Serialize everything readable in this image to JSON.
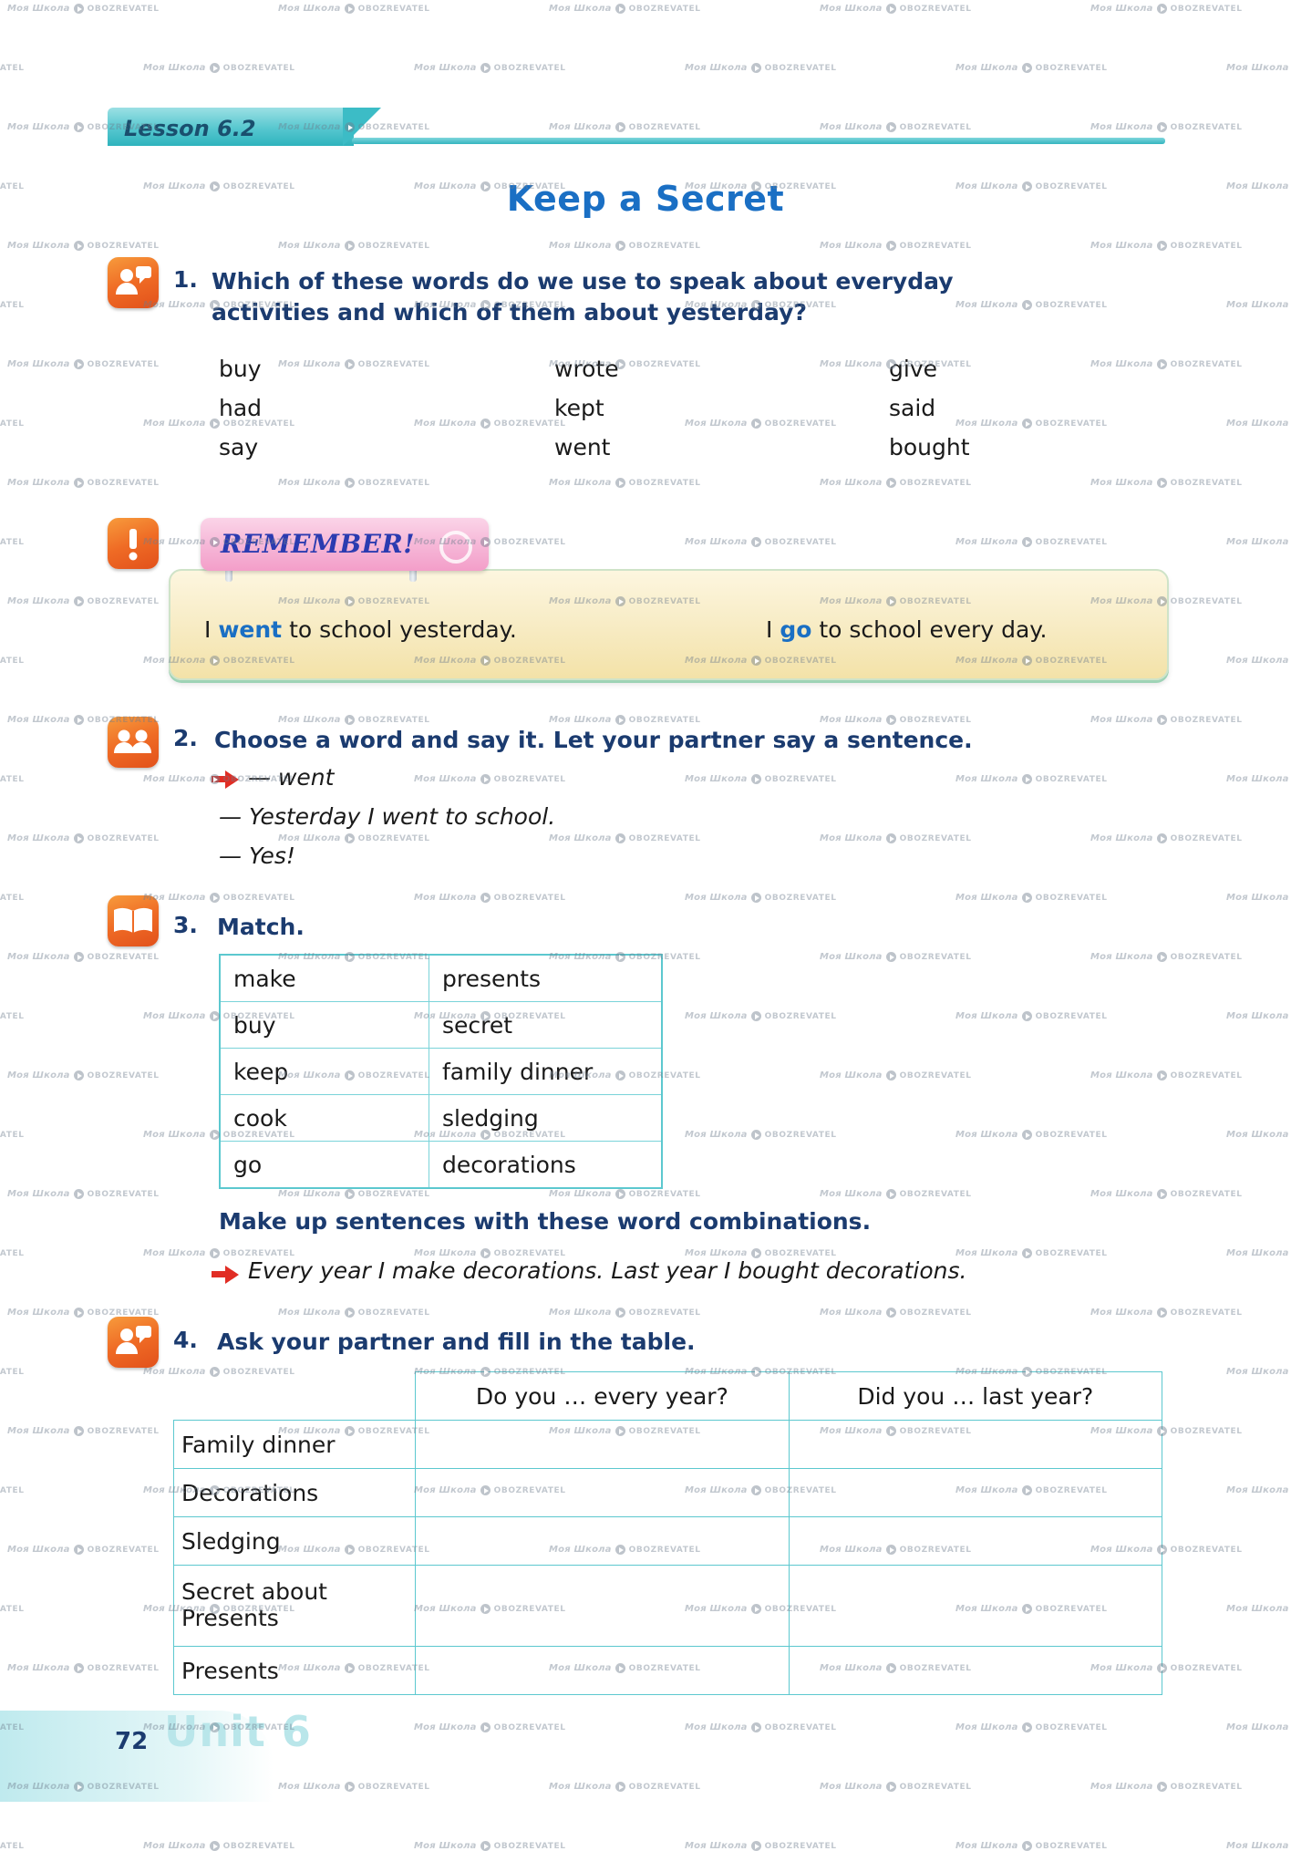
{
  "lesson": {
    "tab_label": "Lesson 6.2",
    "title": "Keep a Secret"
  },
  "tasks": [
    {
      "number": "1.",
      "icon": "person-speech-icon",
      "text_line1": "Which of these words do we use to speak about everyday",
      "text_line2": "activities and which of them about yesterday?",
      "words": {
        "col1": [
          "buy",
          "had",
          "say"
        ],
        "col2": [
          "wrote",
          "kept",
          "went"
        ],
        "col3": [
          "give",
          "said",
          "bought"
        ]
      }
    },
    {
      "number": "2.",
      "icon": "two-people-icon",
      "text": "Choose a word and say it. Let your partner say a sentence.",
      "dialog": [
        "— went",
        "— Yesterday I went to school.",
        "— Yes!"
      ]
    },
    {
      "number": "3.",
      "icon": "open-book-icon",
      "text": "Match.",
      "match_rows": [
        {
          "left": "make",
          "right": "presents"
        },
        {
          "left": "buy",
          "right": "secret"
        },
        {
          "left": "keep",
          "right": "family dinner"
        },
        {
          "left": "cook",
          "right": "sledging"
        },
        {
          "left": "go",
          "right": "decorations"
        }
      ],
      "followup_bold": "Make up sentences with these word combinations.",
      "followup_example": "Every year I make decorations. Last year I bought decorations."
    },
    {
      "number": "4.",
      "icon": "person-speech-icon",
      "text": "Ask your partner and fill in the table.",
      "table": {
        "headers": [
          "",
          "Do you … every year?",
          "Did you … last year?"
        ],
        "rows": [
          "Family dinner",
          "Decorations",
          "Sledging",
          "Secret about\nPresents",
          "Presents"
        ]
      }
    }
  ],
  "remember": {
    "badge": "REMEMBER!",
    "icon": "exclamation-icon",
    "left_pre": "I ",
    "left_bold": "went",
    "left_post": " to school yesterday.",
    "right_pre": "I ",
    "right_bold": "go",
    "right_post": " to school every day."
  },
  "footer": {
    "page_number": "72",
    "unit": "Unit 6"
  },
  "watermark": {
    "text_a": "Моя Школа",
    "text_b": "OBOZREVATEL"
  },
  "colors": {
    "title_blue": "#1a6fc4",
    "heading_navy": "#1b3b6f",
    "teal": "#3cbcc6",
    "orange": "#ef6b25",
    "red_arrow": "#e12d24"
  }
}
